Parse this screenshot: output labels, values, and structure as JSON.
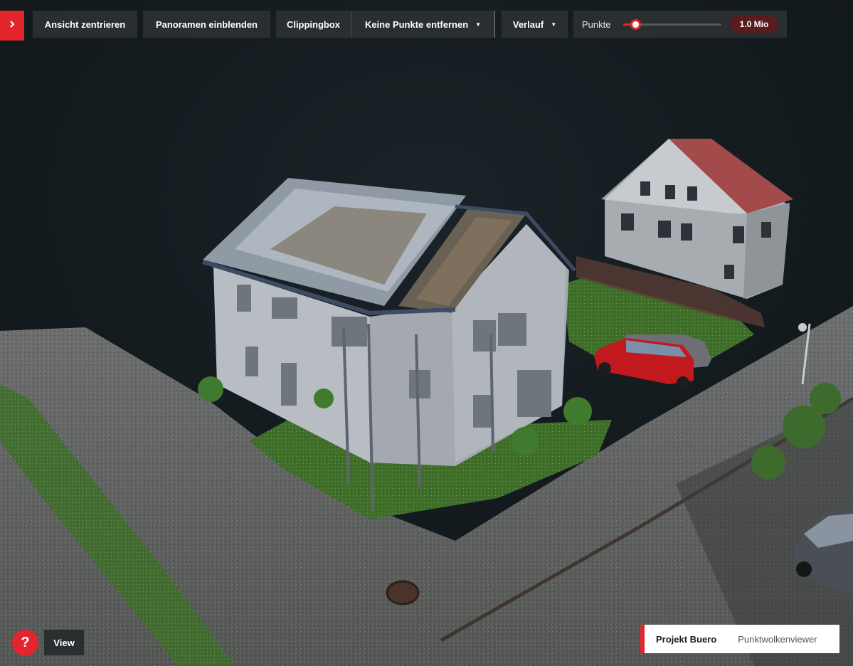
{
  "toolbar": {
    "center_view": "Ansicht zentrieren",
    "show_panoramas": "Panoramen einblenden",
    "clipping_box": "Clippingbox",
    "remove_points": "Keine Punkte entfernen",
    "gradient": "Verlauf",
    "points_label": "Punkte",
    "points_value": "1.0 Mio",
    "points_level": 0.12
  },
  "bottom": {
    "help": "?",
    "view": "View"
  },
  "project": {
    "name": "Projekt Buero",
    "subtitle": "Punktwolkenviewer"
  },
  "colors": {
    "accent": "#e3262d",
    "toolbar_bg": "#2b2e31",
    "badge_bg": "#5a1c1e"
  },
  "icons": {
    "sidebar_toggle": "chevron-right-icon",
    "dropdown": "caret-down-icon"
  }
}
